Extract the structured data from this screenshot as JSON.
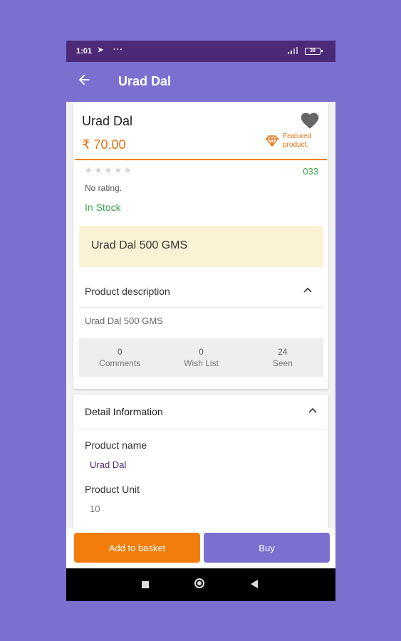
{
  "status_bar": {
    "time": "1:01",
    "battery": "38"
  },
  "app_bar": {
    "title": "Urad Dal"
  },
  "product": {
    "name": "Urad Dal",
    "price": "₹ 70.00",
    "featured_label": "Featured product.",
    "rating_stars": "★★★★★",
    "rating_value": 0,
    "code": "033",
    "rating_text": "No rating.",
    "stock": "In Stock",
    "highlight": "Urad Dal 500 GMS"
  },
  "description": {
    "title": "Product description",
    "body": "Urad Dal 500 GMS"
  },
  "stats": [
    {
      "value": "0",
      "label": "Comments"
    },
    {
      "value": "0",
      "label": "Wish List"
    },
    {
      "value": "24",
      "label": "Seen"
    }
  ],
  "details": {
    "title": "Detail Information",
    "name_label": "Product name",
    "name_value": "Urad Dal",
    "unit_label": "Product Unit",
    "unit_value": "10"
  },
  "actions": {
    "add_to_basket": "Add to basket",
    "buy": "Buy"
  },
  "colors": {
    "app_bar": "#7b70d0",
    "status_bar": "#4c2a78",
    "accent_orange": "#f27d0a",
    "in_stock_green": "#3aa64a"
  },
  "icons": [
    "back-arrow-icon",
    "heart-icon",
    "diamond-icon",
    "chevron-up-icon",
    "nav-square-icon",
    "nav-home-icon",
    "nav-back-icon"
  ]
}
